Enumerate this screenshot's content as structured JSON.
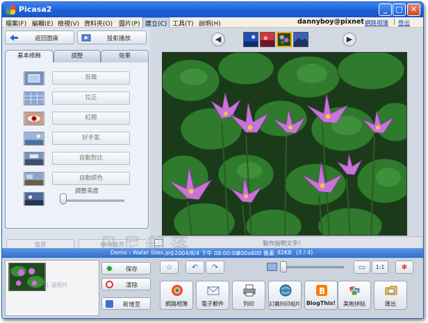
{
  "window": {
    "title": "Picasa2"
  },
  "menu": {
    "items": [
      "檔案(F)",
      "編輯(E)",
      "檢視(V)",
      "資料夾(O)",
      "圖片(P)",
      "建立(C)",
      "工具(T)",
      "說明(H)"
    ],
    "active_index": 5,
    "user": "dannyboy@pixnet",
    "web_album_link": "網路相簿",
    "logout_link": "登出",
    "separator": "|"
  },
  "left": {
    "back_button": "返回圖庫",
    "slideshow_button": "投影播放",
    "tabs": [
      "基本修飾",
      "調整",
      "效果"
    ],
    "active_tab": 0,
    "fixes": [
      "剪裁",
      "拉正",
      "紅眼",
      "好手氣",
      "自動對比",
      "自動調色"
    ],
    "brightness_label": "調整亮度",
    "brightness_level": 0.0,
    "undo_button": "復原",
    "redo_button": "取消復原"
  },
  "viewer": {
    "caption_placeholder": "製作說明文字！",
    "watermark": "丹尼部落"
  },
  "info": {
    "path": "Demo › Water lilies.jpg",
    "date": "2004/8/4 下午 08:00:00",
    "dimensions": "800x600 像素",
    "size": "82KB",
    "position": "(3 / 4)"
  },
  "tray": {
    "label": "1 張相片",
    "hold_button": "保存",
    "clear_button": "清除",
    "add_to_button": "新增至",
    "zoom_level": 0.0,
    "fit_button": "",
    "actual_button": "1:1",
    "actions": [
      "網路相簿",
      "電子郵件",
      "列印",
      "訂購列印相片",
      "BlogThis!",
      "美術拼貼",
      "匯出"
    ]
  },
  "colors": {
    "titlebar": "#1c5fd6",
    "infobar": "#2f6fcf",
    "link": "#1b3fb0"
  },
  "icons": {
    "back": "back-arrow-icon",
    "slideshow": "slideshow-icon",
    "prev": "left-arrow-icon",
    "next": "right-arrow-icon",
    "star": "star-icon",
    "rotate_left": "rotate-left-icon",
    "rotate_right": "rotate-right-icon"
  }
}
